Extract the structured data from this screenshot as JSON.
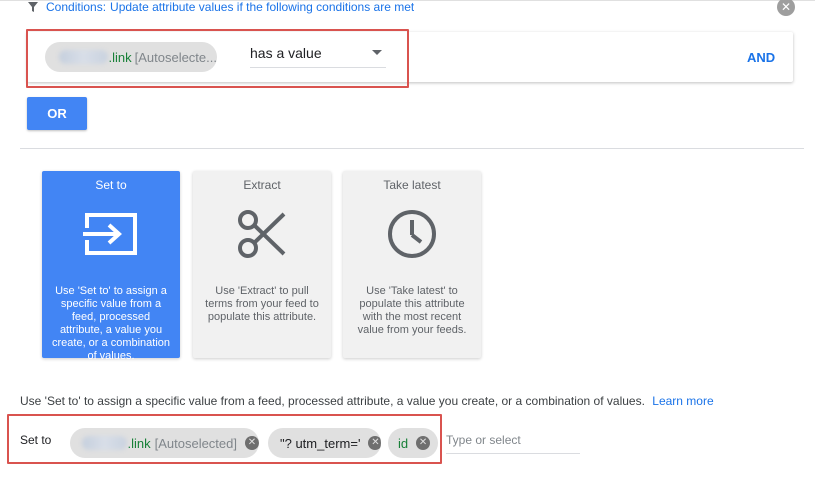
{
  "conditions": {
    "label": "Conditions:",
    "text": "Update attribute values if the following conditions are met",
    "close_icon": "close-circle-icon",
    "attribute_chip": {
      "suffix": ".link",
      "note": "[Autoselecte..."
    },
    "operator": {
      "selected": "has a value"
    },
    "and_label": "AND",
    "or_label": "OR"
  },
  "modes": [
    {
      "title": "Set to",
      "icon": "set-to-arrow-box-icon",
      "description": "Use 'Set to' to assign a specific value from a feed, processed attribute, a value you create, or a combination of values.",
      "active": true
    },
    {
      "title": "Extract",
      "icon": "scissors-icon",
      "description": "Use 'Extract' to pull terms from your feed to populate this attribute.",
      "active": false
    },
    {
      "title": "Take latest",
      "icon": "clock-icon",
      "description": "Use 'Take latest' to populate this attribute with the most recent value from your feeds.",
      "active": false
    }
  ],
  "info": {
    "text": "Use 'Set to' to assign a specific value from a feed, processed attribute, a value you create, or a combination of values.",
    "learn_more": "Learn more"
  },
  "set_to": {
    "label": "Set to",
    "chips": [
      {
        "suffix": ".link",
        "note": "[Autoselected]"
      },
      {
        "text": "\"? utm_term='"
      },
      {
        "text": "id"
      }
    ],
    "placeholder": "Type or select"
  },
  "colors": {
    "accent": "#4285f4",
    "link": "#1a73e8",
    "highlight": "#d9534f",
    "attribute_green": "#188038"
  }
}
